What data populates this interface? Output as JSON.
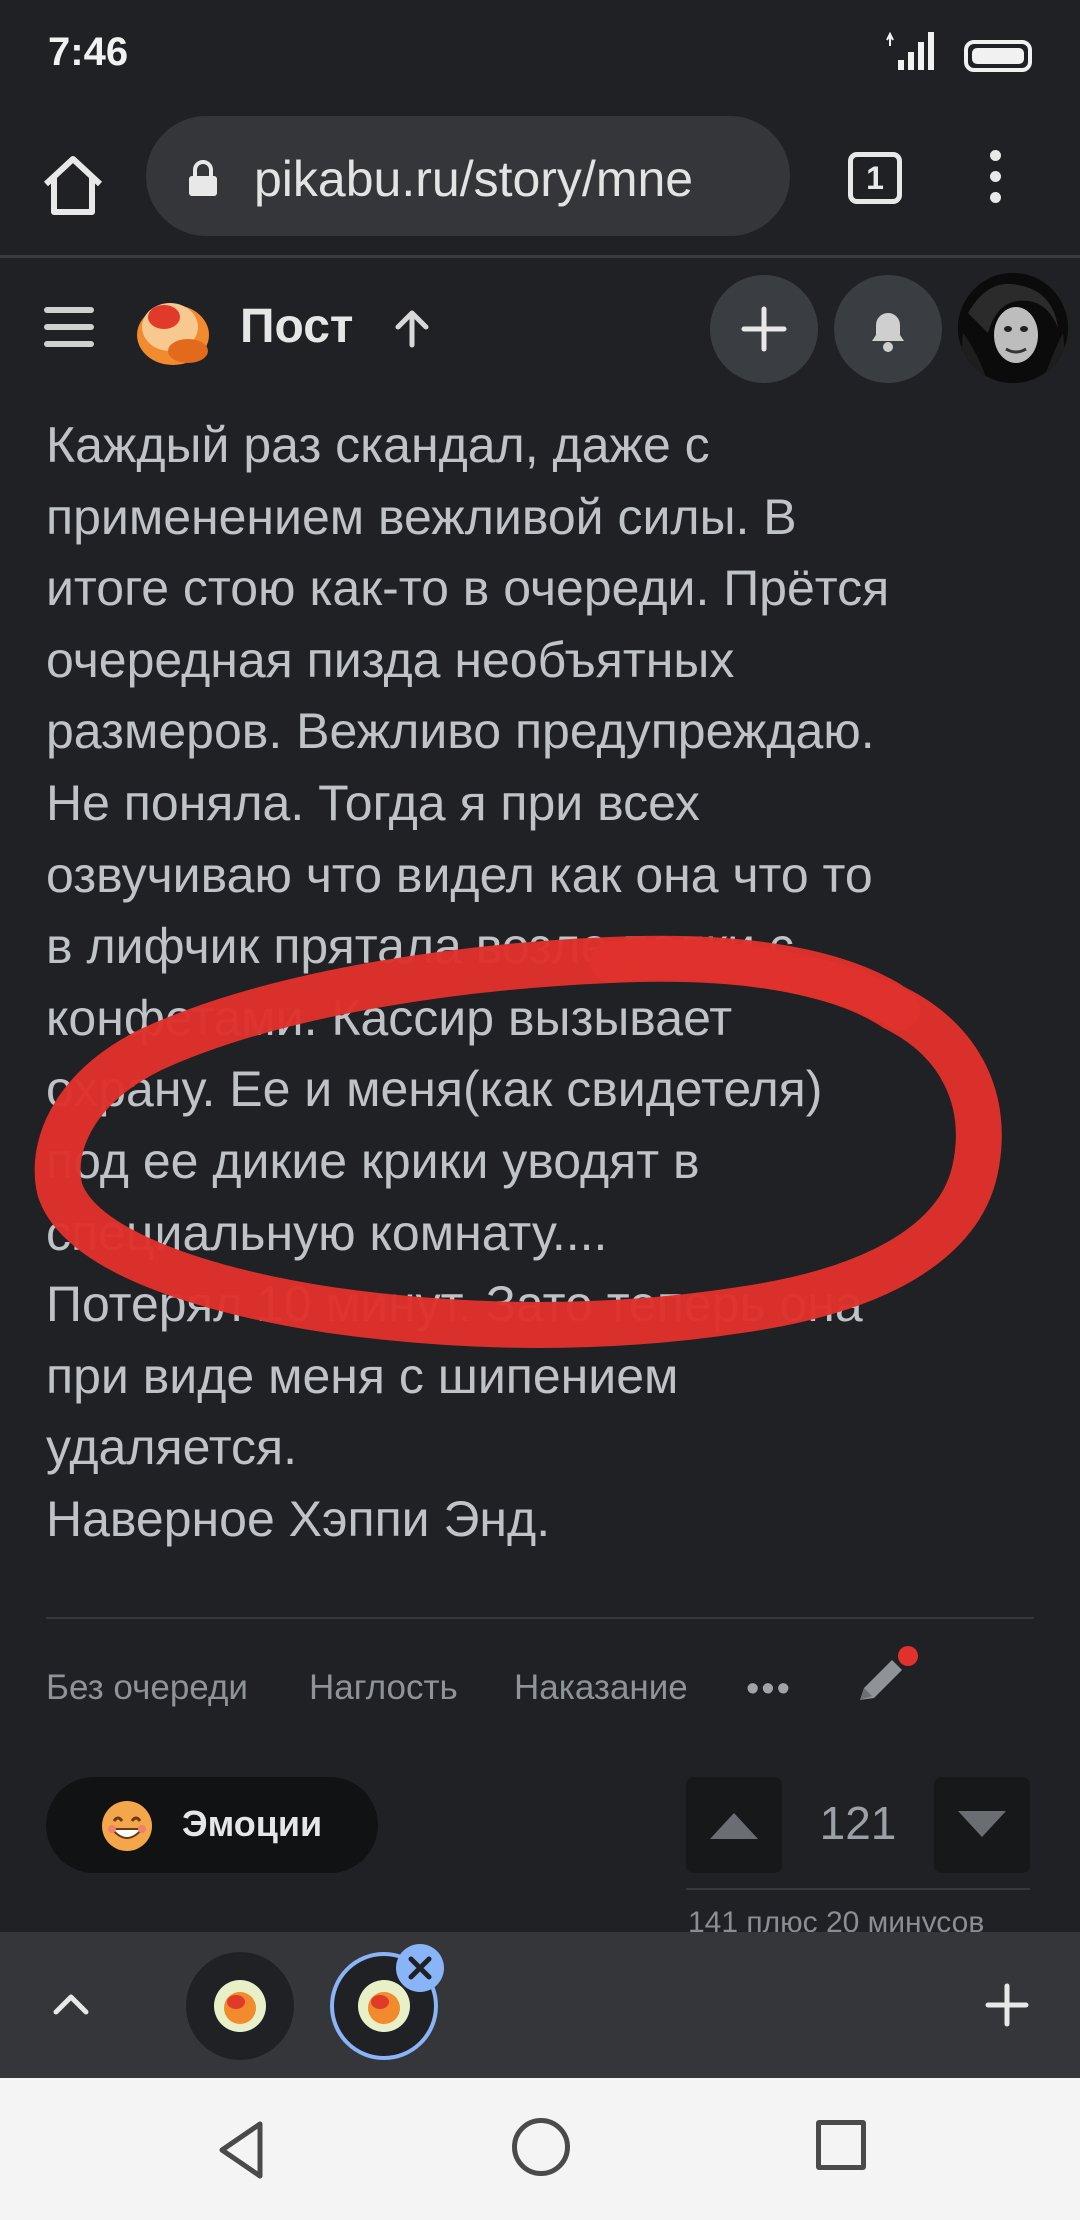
{
  "status_bar": {
    "time": "7:46"
  },
  "browser": {
    "url": "pikabu.ru/story/mne",
    "tab_count": "1"
  },
  "site_header": {
    "title": "Пост"
  },
  "article": {
    "lines": [
      "Каждый раз скандал, даже с",
      "применением вежливой силы. В",
      "итоге стою как-то в очереди. Прётся",
      "очередная пизда необъятных",
      "размеров. Вежливо предупреждаю.",
      "Не поняла. Тогда я при всех",
      "озвучиваю что видел как она что то",
      "в лифчик прятала возле полки с",
      "конфетами. Кассир вызывает",
      "охрану. Ее и меня(как свидетеля)",
      "под ее дикие крики уводят в",
      "специальную комнату....",
      "Потерял 10 минут. Зато теперь она",
      "при виде меня с шипением",
      "удаляется.",
      "Наверное Хэппи Энд."
    ]
  },
  "tags": [
    "Без очереди",
    "Наглость",
    "Наказание"
  ],
  "more_tags": "•••",
  "emotions_label": "Эмоции",
  "rating": {
    "score": "121",
    "detail": "141 плюс 20 минусов"
  },
  "colors": {
    "annotation_red": "#e0312c",
    "background": "#1f2124",
    "tab_highlight": "#8ab4f8"
  }
}
